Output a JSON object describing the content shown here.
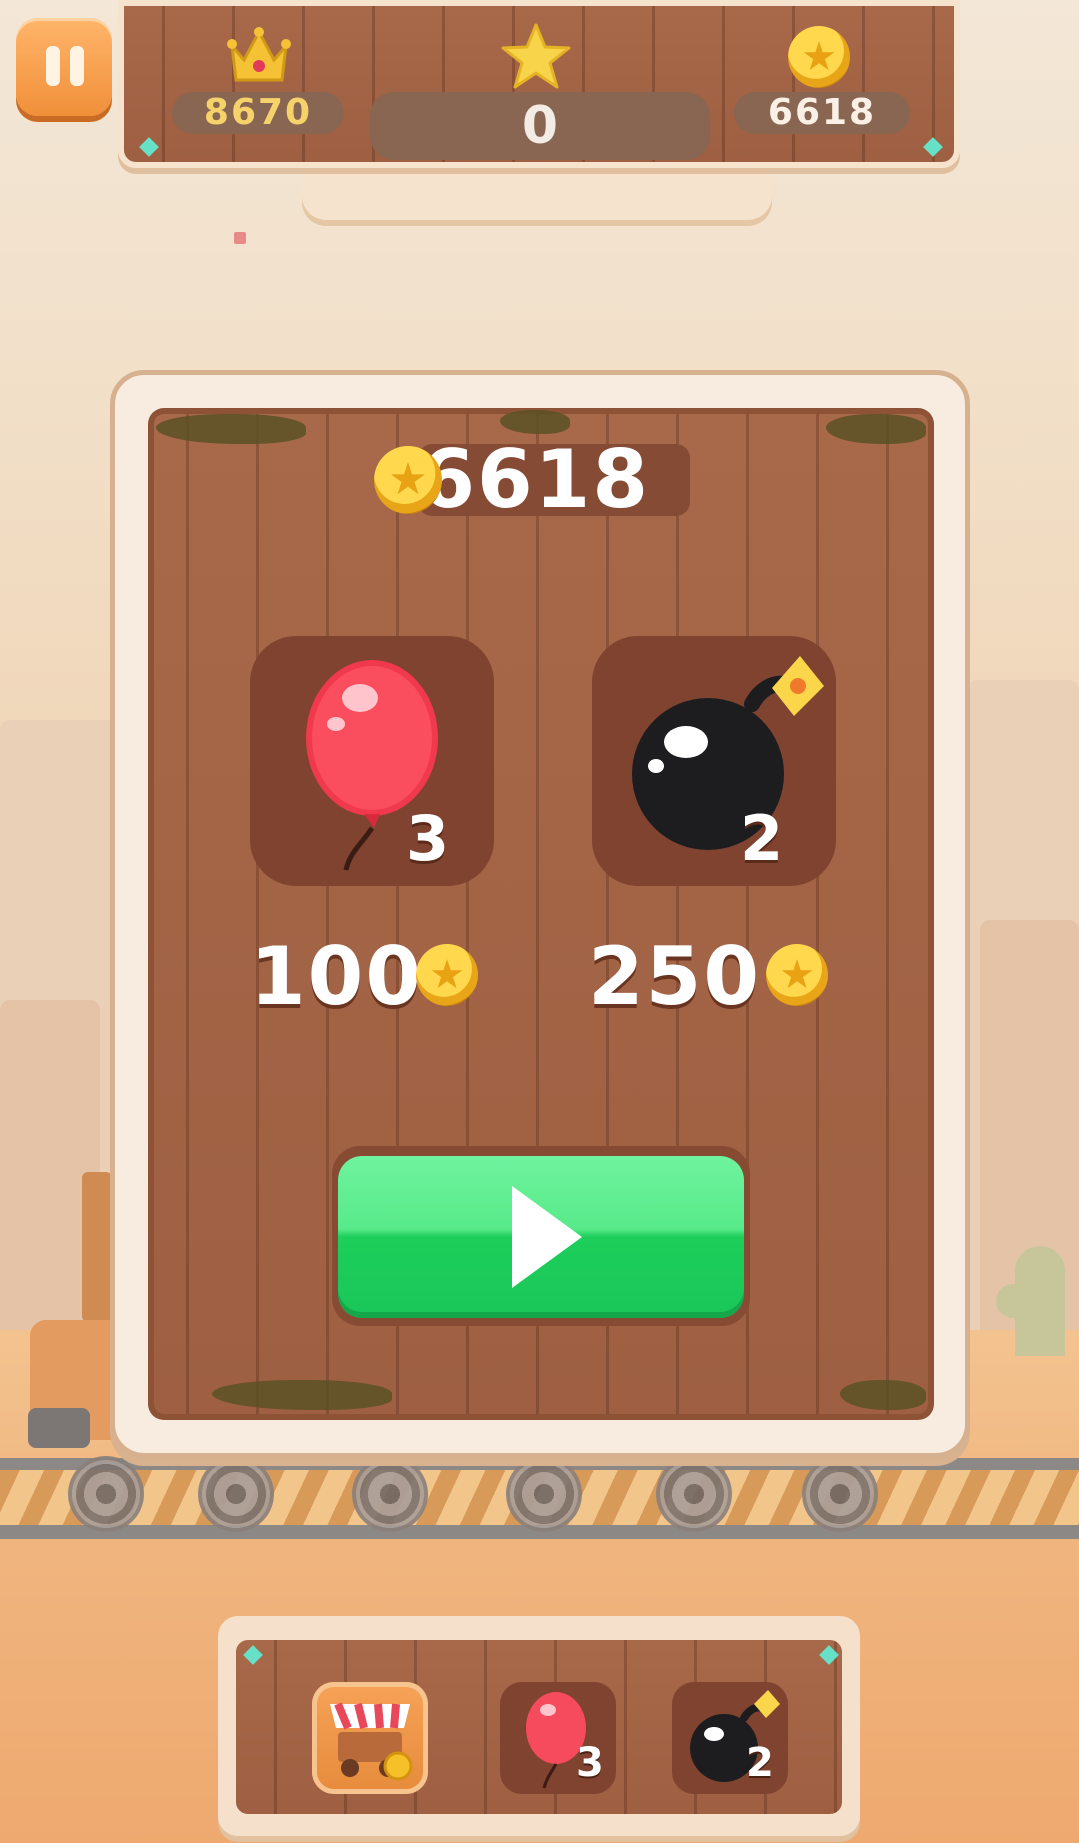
{
  "hud": {
    "best_score": "8670",
    "current_score": "0",
    "coins": "6618"
  },
  "shop": {
    "balance": "6618",
    "items": [
      {
        "name": "balloon",
        "count": "3",
        "price": "100"
      },
      {
        "name": "bomb",
        "count": "2",
        "price": "250"
      }
    ]
  },
  "toolbar": {
    "balloon_count": "3",
    "bomb_count": "2"
  },
  "icons": {
    "pause": "pause-icon",
    "crown": "crown-icon",
    "star": "star-icon",
    "coin": "coin-icon",
    "balloon": "balloon-icon",
    "bomb": "bomb-icon",
    "play": "play-icon",
    "shop": "shop-cart-icon"
  },
  "colors": {
    "play_button": "#22d162",
    "pause_button": "#f39a48",
    "gold_text": "#f6d36a",
    "wood": "#a66748",
    "frame": "#f7ecdf"
  }
}
